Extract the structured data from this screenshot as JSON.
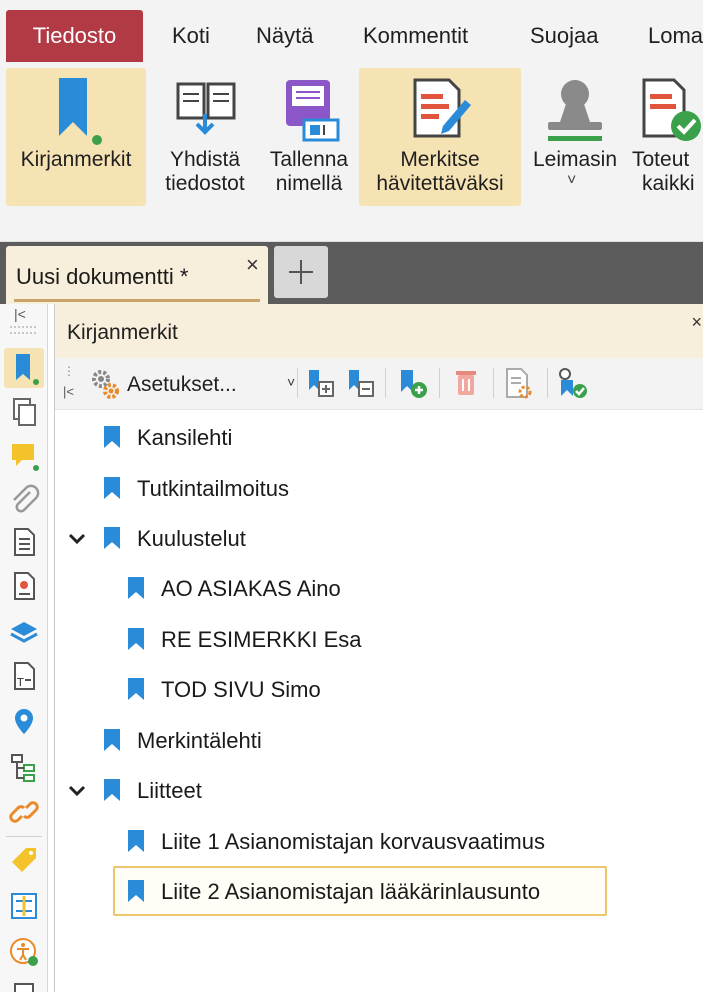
{
  "menu": {
    "tabs": [
      "Tiedosto",
      "Koti",
      "Näytä",
      "Kommentit",
      "Suojaa",
      "Loma"
    ]
  },
  "ribbon": {
    "buttons": [
      {
        "line1": "Kirjanmerkit",
        "line2": "",
        "icon": "bookmark-icon",
        "active": true
      },
      {
        "line1": "Yhdistä",
        "line2": "tiedostot",
        "icon": "merge-files-icon",
        "active": false
      },
      {
        "line1": "Tallenna",
        "line2": "nimellä",
        "icon": "save-as-icon",
        "active": false
      },
      {
        "line1": "Merkitse",
        "line2": "hävitettäväksi",
        "icon": "mark-redaction-icon",
        "active": true
      },
      {
        "line1": "Leimasin",
        "line2": "˅",
        "icon": "stamp-icon",
        "active": false
      },
      {
        "line1": "Toteut",
        "line2": "kaikki",
        "icon": "apply-all-icon",
        "active": false
      }
    ]
  },
  "document_tab": {
    "title": "Uusi dokumentti",
    "modified_marker": "*",
    "close_glyph": "×"
  },
  "panel": {
    "title": "Kirjanmerkit",
    "close_glyph": "×",
    "options_label": "Asetukset...",
    "collapse_glyph": "|<"
  },
  "bookmarks": [
    {
      "label": "Kansilehti",
      "level": 0,
      "expanded": null
    },
    {
      "label": "Tutkintailmoitus",
      "level": 0,
      "expanded": null
    },
    {
      "label": "Kuulustelut",
      "level": 0,
      "expanded": true
    },
    {
      "label": "AO ASIAKAS Aino",
      "level": 1,
      "expanded": null
    },
    {
      "label": "RE ESIMERKKI Esa",
      "level": 1,
      "expanded": null
    },
    {
      "label": "TOD SIVU Simo",
      "level": 1,
      "expanded": null
    },
    {
      "label": "Merkintälehti",
      "level": 0,
      "expanded": null
    },
    {
      "label": "Liitteet",
      "level": 0,
      "expanded": true
    },
    {
      "label": "Liite 1 Asianomistajan korvausvaatimus",
      "level": 1,
      "expanded": null
    },
    {
      "label": "Liite 2 Asianomistajan lääkärinlausunto",
      "level": 1,
      "expanded": null,
      "selected": true
    }
  ],
  "colors": {
    "file_tab": "#b23a45",
    "active_highlight": "#f6e3b4",
    "bookmark_blue": "#2a8bd8",
    "selection_border": "#ecc66d",
    "tabstrip": "#5c5c5c"
  }
}
